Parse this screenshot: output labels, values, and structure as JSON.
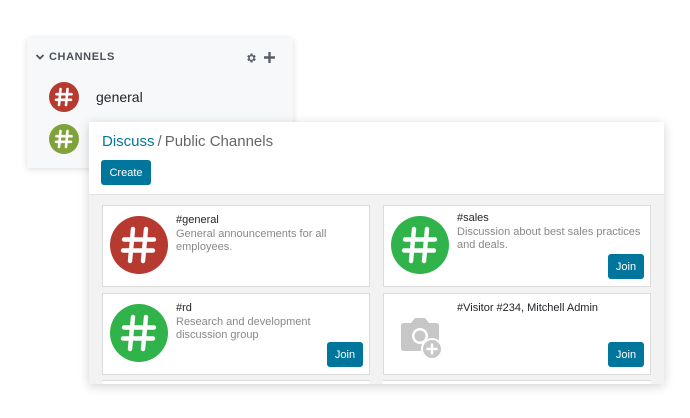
{
  "sidebar": {
    "title": "CHANNELS",
    "items": [
      {
        "label": "general",
        "color": "#b73a31"
      },
      {
        "label": "",
        "color": "#7fa23b"
      }
    ]
  },
  "breadcrumb": {
    "root": "Discuss",
    "separator": "/",
    "current": "Public Channels"
  },
  "toolbar": {
    "create_label": "Create"
  },
  "channels": [
    {
      "name": "#general",
      "description": "General announcements for all employees.",
      "join": "",
      "color": "#b73a31",
      "icon": "hash-icon"
    },
    {
      "name": "#sales",
      "description": "Discussion about best sales practices and deals.",
      "join": "Join",
      "color": "#2fb34a",
      "icon": "hash-icon"
    },
    {
      "name": "#rd",
      "description": "Research and development discussion group",
      "join": "Join",
      "color": "#2fb34a",
      "icon": "hash-icon"
    },
    {
      "name": "#Visitor #234, Mitchell Admin",
      "description": "",
      "join": "Join",
      "color": "#c7c7c7",
      "icon": "camera-add-icon"
    }
  ],
  "colors": {
    "primary": "#00769c",
    "link": "#00769c"
  }
}
